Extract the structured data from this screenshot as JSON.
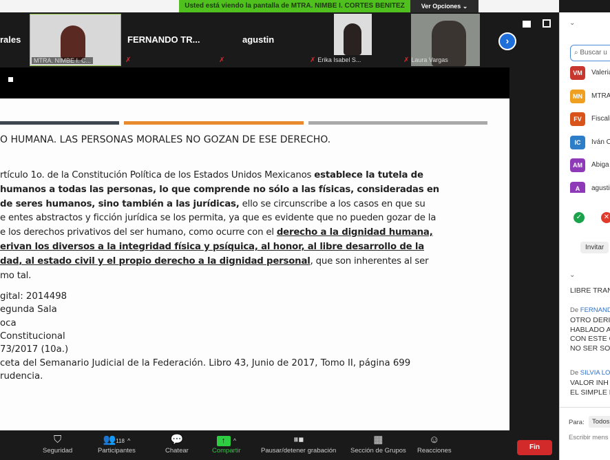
{
  "banner": {
    "text": "Usted está viendo la pantalla de MTRA. NIMBE I. CORTES BENITEZ",
    "options": "Ver Opciones ⌄"
  },
  "videos": [
    {
      "name": "rales"
    },
    {
      "label": "MTRA. NIMBE I. C..."
    },
    {
      "name": "FERNANDO  TR..."
    },
    {
      "name": "agustin"
    },
    {
      "label": "Erika Isabel S..."
    },
    {
      "label": "Laura Vargas"
    }
  ],
  "slide": {
    "title": "O HUMANA. LAS PERSONAS MORALES NO GOZAN DE ESE DERECHO.",
    "paragraph": [
      [
        {
          "t": "rtículo 1o. de la Constitución Política de los Estados Unidos Mexicanos "
        },
        {
          "b": "establece la tutela de"
        }
      ],
      [
        {
          "b": "humanos a todas las personas, lo que comprende no sólo a las físicas, consideradas en"
        }
      ],
      [
        {
          "b": " de seres humanos, sino también a las jurídicas,"
        },
        {
          "t": " ello se circunscribe a los casos en que su"
        }
      ],
      [
        {
          "t": "e entes abstractos y ficción jurídica se los permita, ya que es evidente que no pueden gozar de la"
        }
      ],
      [
        {
          "t": "e los derechos privativos del ser humano, como ocurre con el "
        },
        {
          "u": "derecho a la dignidad humana,"
        }
      ],
      [
        {
          "u": "erivan los diversos a la integridad física y psíquica, al honor, al libre desarrollo de la"
        }
      ],
      [
        {
          "u": "dad, al estado civil y el propio derecho a la dignidad personal"
        },
        {
          "t": ", que son inherentes al ser"
        }
      ],
      [
        {
          "t": "mo tal."
        }
      ]
    ],
    "meta": [
      "gital: 2014498",
      "egunda Sala",
      "oca",
      " Constitucional",
      "73/2017 (10a.)",
      "ceta del Semanario Judicial de la Federación. Libro 43, Junio de 2017, Tomo II, página 699",
      "rudencia."
    ]
  },
  "sidebar": {
    "search_placeholder": "Buscar u",
    "participants": [
      {
        "initials": "VM",
        "name": "Valeria",
        "color": "#c8372d"
      },
      {
        "initials": "MN",
        "name": "MTRA.",
        "color": "#f0a020"
      },
      {
        "initials": "FV",
        "name": "Fiscali",
        "color": "#d9541a"
      },
      {
        "initials": "IC",
        "name": "Iván C",
        "color": "#2d7dc8"
      },
      {
        "initials": "AM",
        "name": "Abiga",
        "color": "#8e3ab8"
      },
      {
        "initials": "A",
        "name": "agusti",
        "color": "#8e3ab8"
      }
    ],
    "invite": "Invitar",
    "chat": {
      "line0": "LIBRE TRAN",
      "from1": "De ",
      "sender1": "FERNAND",
      "msg1": [
        "OTRO DERI",
        "HABLADO A",
        "CON ESTE C",
        "NO SER SO"
      ],
      "from2": "De ",
      "sender2": "SILVIA LOF",
      "msg2": [
        "VALOR INH",
        "EL SIMPLE H"
      ]
    },
    "to_label": "Para:",
    "to_value": "Todos",
    "input_placeholder": "Escribir mens"
  },
  "toolbar": {
    "security": "Seguridad",
    "participants": "Participantes",
    "participant_count": "118",
    "chat": "Chatear",
    "share": "Compartir",
    "record": "Pausar/detener grabación",
    "rooms": "Sección de Grupos",
    "reactions": "Reacciones",
    "end": "Fin"
  }
}
